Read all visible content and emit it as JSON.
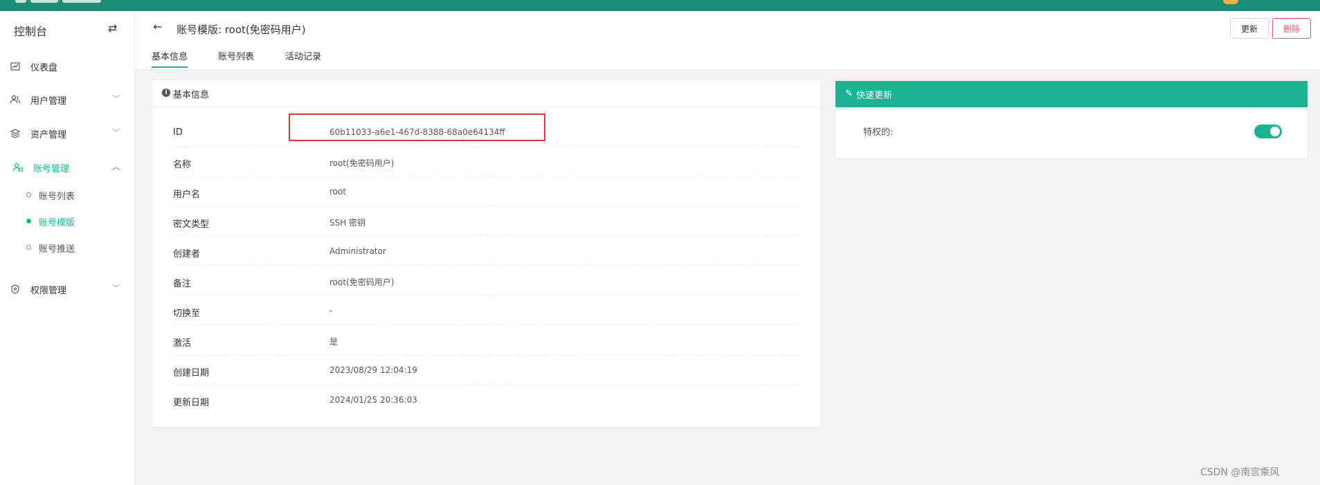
{
  "sidebar": {
    "title": "控制台",
    "menu": [
      {
        "label": "仪表盘",
        "icon": "dashboard-icon"
      },
      {
        "label": "用户管理",
        "icon": "users-icon"
      },
      {
        "label": "资产管理",
        "icon": "layers-icon"
      },
      {
        "label": "账号管理",
        "icon": "accounts-icon",
        "active": true
      },
      {
        "label": "权限管理",
        "icon": "shield-icon"
      }
    ],
    "submenu": [
      {
        "label": "账号列表"
      },
      {
        "label": "账号模版",
        "active": true
      },
      {
        "label": "账号推送"
      }
    ]
  },
  "header": {
    "title": "账号模版: root(免密码用户)",
    "tabs": [
      {
        "label": "基本信息",
        "active": true
      },
      {
        "label": "账号列表"
      },
      {
        "label": "活动记录"
      }
    ],
    "buttons": {
      "update": "更新",
      "delete": "删除"
    }
  },
  "info_panel": {
    "title": "基本信息",
    "rows": [
      {
        "key": "ID",
        "value": "60b11033-a6e1-467d-8388-68a0e64134ff"
      },
      {
        "key": "名称",
        "value": "root(免密码用户)"
      },
      {
        "key": "用户名",
        "value": "root"
      },
      {
        "key": "密文类型",
        "value": "SSH 密钥"
      },
      {
        "key": "创建者",
        "value": "Administrator"
      },
      {
        "key": "备注",
        "value": "root(免密码用户)"
      },
      {
        "key": "切换至",
        "value": "-"
      },
      {
        "key": "激活",
        "value": "是"
      },
      {
        "key": "创建日期",
        "value": "2023/08/29 12:04:19"
      },
      {
        "key": "更新日期",
        "value": "2024/01/25 20:36:03"
      }
    ]
  },
  "quick_panel": {
    "title": "快速更新",
    "privileged_label": "特权的:",
    "privileged": true
  },
  "watermark": "CSDN @南宫乘风",
  "colors": {
    "brand": "#1ab394",
    "topbar": "#1a8d74",
    "danger": "#ed5565",
    "highlight": "#e53535"
  }
}
